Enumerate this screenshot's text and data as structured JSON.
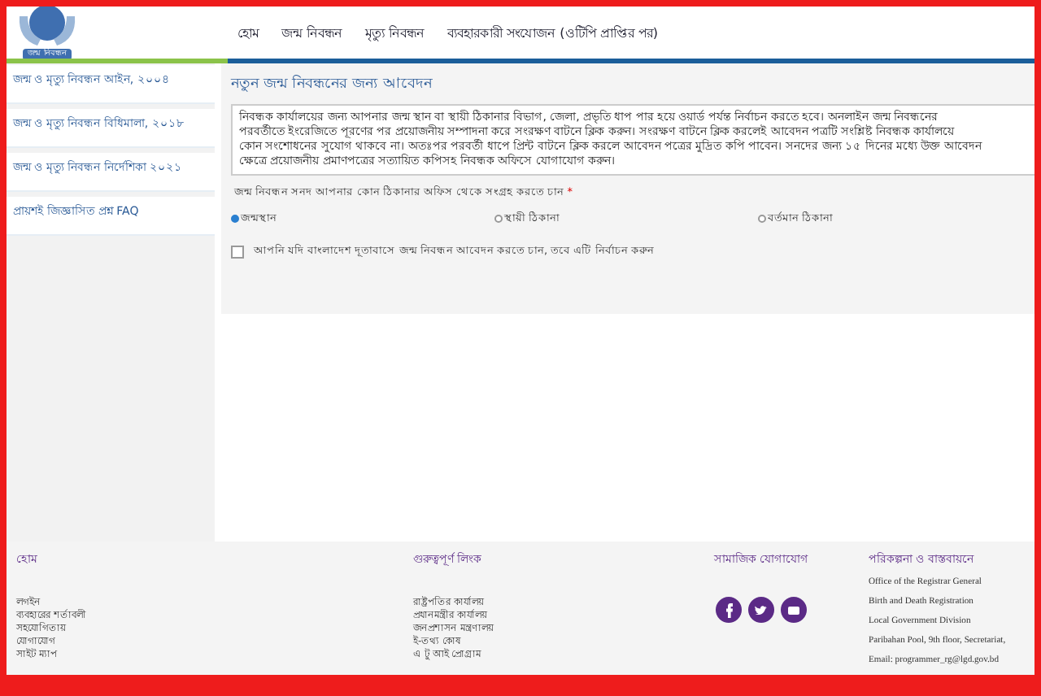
{
  "header": {
    "logo_text": "জন্ম নিবন্ধন",
    "nav": [
      {
        "label": "হোম"
      },
      {
        "label": "জন্ম নিবন্ধন"
      },
      {
        "label": "মৃত্যু নিবন্ধন"
      },
      {
        "label": "ব্যবহারকারী সংযোজন (ওটিপি প্রাপ্তির পর)"
      }
    ]
  },
  "sidebar": {
    "items": [
      {
        "label": "জন্ম ও মৃত্যু নিবন্ধন আইন, ২০০৪"
      },
      {
        "label": "জন্ম ও মৃত্যু নিবন্ধন বিধিমালা, ২০১৮"
      },
      {
        "label": "জন্ম ও মৃত্যু নিবন্ধন নির্দেশিকা ২০২১"
      },
      {
        "label": "প্রায়শই জিজ্ঞাসিত প্রশ্ন FAQ"
      }
    ]
  },
  "form": {
    "title": "নতুন জন্ম নিবন্ধনের জন্য আবেদন",
    "notice_lines": [
      "নিবন্ধক কার্যালয়ের জন্য আপনার জন্ম স্থান বা স্থায়ী ঠিকানার বিভাগ, জেলা, প্রভৃতি ধাপ পার হয়ে ওয়ার্ড পর্যন্ত নির্বাচন করতে হবে। অনলাইন জন্ম নিবন্ধনের",
      "পরবর্তীতে ইংরেজিতে পূরণের পর প্রয়োজনীয় সম্পাদনা করে সংরক্ষণ বাটনে ক্লিক করুন। সংরক্ষণ বাটনে ক্লিক করলেই আবেদন পত্রটি সংশ্লিষ্ট নিবন্ধক কার্যালয়ে",
      "কোন সংশোধনের সুযোগ থাকবে না। অতঃপর পরবর্তী ধাপে প্রিন্ট বাটনে ক্লিক করলে আবেদন পত্রের মুদ্রিত কপি পাবেন। সনদের জন্য ১৫ দিনের মধ্যে উক্ত আবেদন",
      "ক্ষেত্রে প্রয়োজনীয় প্রমাণপত্রের সত্যায়িত কপিসহ নিবন্ধক অফিসে যোগাযোগ করুন।"
    ],
    "question": "জন্ম নিবন্ধন সনদ আপনার কোন ঠিকানার অফিস থেকে সংগ্রহ করতে চান",
    "required_mark": "*",
    "options": [
      {
        "label": "জন্মস্থান",
        "selected": true
      },
      {
        "label": "স্থায়ী ঠিকানা",
        "selected": false
      },
      {
        "label": "বর্তমান ঠিকানা",
        "selected": false
      }
    ],
    "abroad": {
      "label": "আপনি যদি বাংলাদেশ দূতাবাসে জন্ম নিবন্ধন আবেদন করতে চান, তবে এটি নির্বাচন করুন",
      "checked": false
    }
  },
  "footer": {
    "columns": [
      {
        "kind": "links",
        "heading": "হোম",
        "items": [
          "লগইন",
          "ব্যবহারের শর্তাবলী",
          "সহযোগিতায়",
          "যোগাযোগ",
          "সাইট ম্যাপ"
        ]
      },
      {
        "kind": "links",
        "heading": "গুরুত্বপূর্ণ লিংক",
        "items": [
          "রাষ্ট্রপতির কার্যালয়",
          "প্রধানমন্ত্রীর কার্যালয়",
          "জনপ্রশাসন মন্ত্রণালয়",
          "ই-তথ্য কোষ",
          "এ টু আই প্রোগ্রাম"
        ]
      },
      {
        "kind": "social",
        "heading": "সামাজিক যোগাযোগ"
      },
      {
        "kind": "info",
        "heading": "পরিকল্পনা ও বাস্তবায়নে",
        "items": [
          "Office of the Registrar General",
          "Birth and Death Registration",
          "Local Government Division",
          "Paribahan Pool, 9th floor, Secretariat,",
          "Email: programmer_rg@lgd.gov.bd"
        ]
      }
    ]
  }
}
